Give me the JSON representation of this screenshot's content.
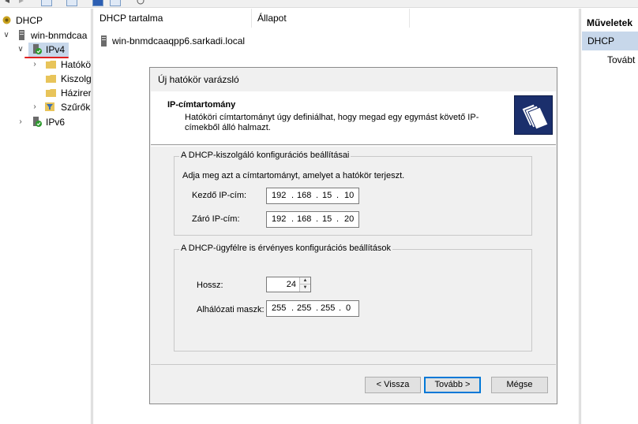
{
  "tree": {
    "root_label": "DHCP",
    "server_label": "win-bnmdcaa",
    "ipv4_label": "IPv4",
    "children": [
      "Hatókö",
      "Kiszolg",
      "Házirer",
      "Szűrők"
    ],
    "ipv6_label": "IPv6"
  },
  "center": {
    "col_name": "DHCP tartalma",
    "col_status": "Állapot",
    "server_row": "win-bnmdcaaqpp6.sarkadi.local"
  },
  "actions": {
    "header": "Műveletek",
    "selected": "DHCP",
    "item": "Továbt"
  },
  "wizard": {
    "title": "Új hatókör varázsló",
    "header_title": "IP-címtartomány",
    "header_desc": "Hatóköri címtartományt úgy definiálhat, hogy megad egy egymást követő IP-címekből álló halmazt.",
    "server_group": {
      "title": "A DHCP-kiszolgáló konfigurációs beállításai",
      "instruction": "Adja meg azt a címtartományt, amelyet a hatókör terjeszt.",
      "start_label": "Kezdő IP-cím:",
      "start_ip": [
        "192",
        "168",
        "15",
        "10"
      ],
      "end_label": "Záró IP-cím:",
      "end_ip": [
        "192",
        "168",
        "15",
        "20"
      ]
    },
    "client_group": {
      "title": "A DHCP-ügyfélre is érvényes konfigurációs beállítások",
      "length_label": "Hossz:",
      "length_value": "24",
      "mask_label": "Alhálózati maszk:",
      "mask": [
        "255",
        "255",
        "255",
        "0"
      ]
    },
    "buttons": {
      "back": "< Vissza",
      "next": "Tovább >",
      "cancel": "Mégse"
    }
  },
  "colors": {
    "selection": "#c7d7ea",
    "ipv4_underline": "#e02020",
    "wizard_bg": "#f0f0f0",
    "default_button_border": "#0078d7"
  }
}
